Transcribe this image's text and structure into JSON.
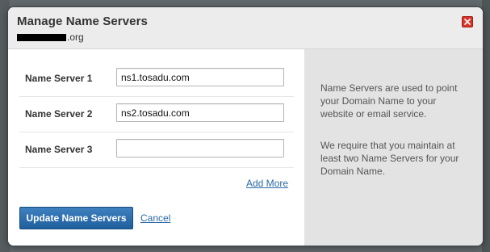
{
  "modal": {
    "title": "Manage Name Servers",
    "domain_suffix": ".org",
    "close_icon": "close-icon"
  },
  "form": {
    "rows": [
      {
        "label": "Name Server 1",
        "value": "ns1.tosadu.com",
        "placeholder": ""
      },
      {
        "label": "Name Server 2",
        "value": "ns2.tosadu.com",
        "placeholder": ""
      },
      {
        "label": "Name Server 3",
        "value": "",
        "placeholder": ""
      }
    ],
    "add_more_label": "Add More",
    "submit_label": "Update Name Servers",
    "cancel_label": "Cancel"
  },
  "help": {
    "paragraph_1": "Name Servers are used to point your Domain Name to your website or email service.",
    "paragraph_2": "We require that you maintain at least two Name Servers for your Domain Name."
  },
  "colors": {
    "primary_button": "#2d6eae",
    "link": "#2a6aa6",
    "close_button": "#d9342b",
    "help_panel": "#e3e3e3"
  }
}
